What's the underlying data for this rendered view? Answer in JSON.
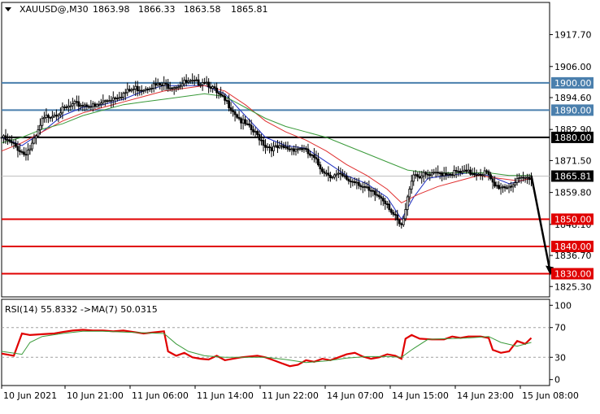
{
  "chart_data": [
    {
      "type": "candlestick",
      "symbol_label": "XAUUSD@,M30",
      "ohlc": [
        "1863.98",
        "1866.33",
        "1863.58",
        "1865.81"
      ],
      "ylim": [
        1821.5,
        1929.5
      ],
      "y_ticks": [
        "1917.70",
        "1906.00",
        "1894.60",
        "1882.90",
        "1871.50",
        "1859.80",
        "1848.10",
        "1836.70",
        "1825.30"
      ],
      "x_ticks": [
        "10 Jun 2021",
        "10 Jun 21:00",
        "11 Jun 06:00",
        "11 Jun 14:00",
        "11 Jun 22:00",
        "14 Jun 07:00",
        "14 Jun 15:00",
        "14 Jun 23:00",
        "15 Jun 08:00"
      ],
      "current_price": 1865.81,
      "current_price_label": "1865.81",
      "levels": [
        {
          "value": 1900.0,
          "label": "1900.00",
          "color": "#4a7fad"
        },
        {
          "value": 1890.0,
          "label": "1890.00",
          "color": "#4a7fad"
        },
        {
          "value": 1880.0,
          "label": "1880.00",
          "color": "#000000"
        },
        {
          "value": 1850.0,
          "label": "1850.00",
          "color": "#e00000"
        },
        {
          "value": 1840.0,
          "label": "1840.00",
          "color": "#e00000"
        },
        {
          "value": 1830.0,
          "label": "1830.00",
          "color": "#e00000"
        }
      ],
      "close_path": [
        [
          0,
          1880
        ],
        [
          4,
          1878
        ],
        [
          8,
          1876
        ],
        [
          11,
          1874
        ],
        [
          14,
          1876
        ],
        [
          17,
          1880
        ],
        [
          20,
          1886
        ],
        [
          23,
          1888
        ],
        [
          27,
          1889
        ],
        [
          30,
          1890
        ],
        [
          33,
          1891
        ],
        [
          36,
          1892
        ],
        [
          40,
          1892
        ],
        [
          43,
          1892
        ],
        [
          46,
          1891
        ],
        [
          50,
          1893
        ],
        [
          53,
          1894
        ],
        [
          56,
          1895
        ],
        [
          60,
          1896
        ],
        [
          63,
          1897
        ],
        [
          66,
          1898
        ],
        [
          70,
          1898
        ],
        [
          73,
          1899
        ],
        [
          76,
          1899
        ],
        [
          80,
          1899
        ],
        [
          83,
          1899
        ],
        [
          86,
          1899
        ],
        [
          90,
          1900
        ],
        [
          93,
          1900
        ],
        [
          96,
          1900
        ],
        [
          100,
          1901
        ],
        [
          103,
          1899
        ],
        [
          106,
          1896
        ],
        [
          109,
          1894
        ],
        [
          112,
          1892
        ],
        [
          115,
          1889
        ],
        [
          118,
          1886
        ],
        [
          121,
          1884
        ],
        [
          124,
          1882
        ],
        [
          127,
          1880
        ],
        [
          130,
          1877
        ],
        [
          134,
          1876
        ],
        [
          137,
          1876
        ],
        [
          140,
          1876
        ],
        [
          144,
          1876
        ],
        [
          148,
          1876
        ],
        [
          151,
          1874
        ],
        [
          154,
          1872
        ],
        [
          157,
          1869
        ],
        [
          160,
          1867
        ],
        [
          163,
          1866
        ],
        [
          166,
          1866
        ],
        [
          169,
          1865
        ],
        [
          172,
          1864
        ],
        [
          175,
          1864
        ],
        [
          178,
          1862
        ],
        [
          181,
          1860
        ],
        [
          184,
          1859
        ],
        [
          187,
          1858
        ],
        [
          190,
          1856
        ],
        [
          192,
          1853
        ],
        [
          195,
          1849
        ],
        [
          197,
          1847
        ],
        [
          199,
          1853
        ],
        [
          201,
          1862
        ],
        [
          203,
          1867
        ],
        [
          205,
          1866
        ],
        [
          208,
          1866
        ],
        [
          212,
          1866
        ],
        [
          216,
          1867
        ],
        [
          220,
          1867
        ],
        [
          224,
          1867
        ],
        [
          228,
          1867
        ],
        [
          232,
          1867
        ],
        [
          236,
          1867
        ],
        [
          239,
          1867
        ],
        [
          241,
          1864
        ],
        [
          243,
          1862
        ],
        [
          246,
          1862
        ],
        [
          249,
          1862
        ],
        [
          252,
          1863
        ],
        [
          255,
          1864
        ],
        [
          258,
          1865
        ],
        [
          260,
          1865
        ],
        [
          261,
          1866
        ]
      ],
      "ma_series": [
        {
          "color": "#2030c0",
          "points": [
            [
              0,
              1880
            ],
            [
              10,
              1877
            ],
            [
              20,
              1882
            ],
            [
              30,
              1888
            ],
            [
              40,
              1891
            ],
            [
              50,
              1892
            ],
            [
              60,
              1894
            ],
            [
              70,
              1897
            ],
            [
              80,
              1899
            ],
            [
              90,
              1899
            ],
            [
              100,
              1899
            ],
            [
              110,
              1896
            ],
            [
              120,
              1888
            ],
            [
              130,
              1880
            ],
            [
              140,
              1877
            ],
            [
              150,
              1876
            ],
            [
              160,
              1871
            ],
            [
              170,
              1866
            ],
            [
              180,
              1863
            ],
            [
              190,
              1858
            ],
            [
              197,
              1850
            ],
            [
              203,
              1858
            ],
            [
              210,
              1865
            ],
            [
              220,
              1866
            ],
            [
              230,
              1867
            ],
            [
              240,
              1866
            ],
            [
              250,
              1863
            ],
            [
              261,
              1865
            ]
          ]
        },
        {
          "color": "#e03030",
          "points": [
            [
              0,
              1875
            ],
            [
              10,
              1878
            ],
            [
              20,
              1882
            ],
            [
              30,
              1886
            ],
            [
              40,
              1889
            ],
            [
              50,
              1891
            ],
            [
              60,
              1893
            ],
            [
              70,
              1895
            ],
            [
              80,
              1897
            ],
            [
              90,
              1898
            ],
            [
              100,
              1899
            ],
            [
              110,
              1897
            ],
            [
              120,
              1892
            ],
            [
              130,
              1886
            ],
            [
              140,
              1882
            ],
            [
              150,
              1879
            ],
            [
              160,
              1875
            ],
            [
              170,
              1870
            ],
            [
              180,
              1866
            ],
            [
              190,
              1861
            ],
            [
              197,
              1856
            ],
            [
              205,
              1859
            ],
            [
              215,
              1862
            ],
            [
              225,
              1864
            ],
            [
              235,
              1866
            ],
            [
              245,
              1865
            ],
            [
              255,
              1864
            ],
            [
              261,
              1865
            ]
          ]
        },
        {
          "color": "#3a9a3a",
          "points": [
            [
              0,
              1878
            ],
            [
              10,
              1880
            ],
            [
              20,
              1883
            ],
            [
              30,
              1885
            ],
            [
              40,
              1888
            ],
            [
              50,
              1890
            ],
            [
              60,
              1892
            ],
            [
              70,
              1893
            ],
            [
              80,
              1894
            ],
            [
              90,
              1895
            ],
            [
              100,
              1896
            ],
            [
              110,
              1895
            ],
            [
              120,
              1891
            ],
            [
              130,
              1887
            ],
            [
              140,
              1884
            ],
            [
              150,
              1882
            ],
            [
              160,
              1880
            ],
            [
              170,
              1877
            ],
            [
              180,
              1874
            ],
            [
              190,
              1871
            ],
            [
              200,
              1868
            ],
            [
              210,
              1867
            ],
            [
              220,
              1867
            ],
            [
              230,
              1867
            ],
            [
              240,
              1867
            ],
            [
              250,
              1866
            ],
            [
              261,
              1866
            ]
          ]
        }
      ],
      "projection": {
        "from": [
          261,
          1866
        ],
        "to": [
          270,
          1830
        ]
      }
    },
    {
      "type": "line",
      "label": "RSI(14) 55.8332  ->MA(7) 50.0315",
      "ylim": [
        -8,
        108
      ],
      "y_ticks": [
        "100",
        "70",
        "30",
        "0"
      ],
      "levels": [
        70,
        30
      ],
      "series": [
        {
          "color": "#e00000",
          "points": [
            [
              0,
              35
            ],
            [
              6,
              32
            ],
            [
              10,
              62
            ],
            [
              14,
              60
            ],
            [
              20,
              61
            ],
            [
              26,
              62
            ],
            [
              30,
              64
            ],
            [
              35,
              66
            ],
            [
              40,
              67
            ],
            [
              45,
              66
            ],
            [
              50,
              66
            ],
            [
              55,
              65
            ],
            [
              60,
              66
            ],
            [
              65,
              64
            ],
            [
              70,
              62
            ],
            [
              80,
              65
            ],
            [
              82,
              38
            ],
            [
              86,
              32
            ],
            [
              90,
              36
            ],
            [
              94,
              30
            ],
            [
              98,
              28
            ],
            [
              102,
              27
            ],
            [
              106,
              32
            ],
            [
              110,
              26
            ],
            [
              114,
              28
            ],
            [
              118,
              30
            ],
            [
              122,
              31
            ],
            [
              126,
              32
            ],
            [
              130,
              30
            ],
            [
              134,
              26
            ],
            [
              138,
              22
            ],
            [
              142,
              18
            ],
            [
              146,
              20
            ],
            [
              150,
              26
            ],
            [
              154,
              24
            ],
            [
              158,
              28
            ],
            [
              162,
              26
            ],
            [
              166,
              30
            ],
            [
              170,
              34
            ],
            [
              174,
              36
            ],
            [
              178,
              31
            ],
            [
              182,
              28
            ],
            [
              186,
              30
            ],
            [
              190,
              34
            ],
            [
              194,
              32
            ],
            [
              197,
              28
            ],
            [
              199,
              55
            ],
            [
              202,
              60
            ],
            [
              206,
              55
            ],
            [
              212,
              54
            ],
            [
              218,
              54
            ],
            [
              222,
              58
            ],
            [
              226,
              56
            ],
            [
              230,
              58
            ],
            [
              236,
              58
            ],
            [
              240,
              56
            ],
            [
              242,
              40
            ],
            [
              246,
              36
            ],
            [
              250,
              38
            ],
            [
              254,
              52
            ],
            [
              258,
              48
            ],
            [
              261,
              56
            ]
          ]
        },
        {
          "color": "#3a9a3a",
          "points": [
            [
              0,
              38
            ],
            [
              10,
              34
            ],
            [
              14,
              50
            ],
            [
              20,
              58
            ],
            [
              30,
              62
            ],
            [
              40,
              65
            ],
            [
              50,
              65
            ],
            [
              60,
              64
            ],
            [
              70,
              63
            ],
            [
              80,
              62
            ],
            [
              86,
              48
            ],
            [
              92,
              38
            ],
            [
              100,
              32
            ],
            [
              110,
              30
            ],
            [
              120,
              30
            ],
            [
              130,
              30
            ],
            [
              140,
              27
            ],
            [
              150,
              23
            ],
            [
              160,
              25
            ],
            [
              170,
              29
            ],
            [
              180,
              31
            ],
            [
              190,
              31
            ],
            [
              197,
              30
            ],
            [
              202,
              40
            ],
            [
              210,
              54
            ],
            [
              220,
              55
            ],
            [
              230,
              56
            ],
            [
              240,
              58
            ],
            [
              246,
              50
            ],
            [
              254,
              45
            ],
            [
              261,
              50
            ]
          ]
        }
      ]
    }
  ]
}
